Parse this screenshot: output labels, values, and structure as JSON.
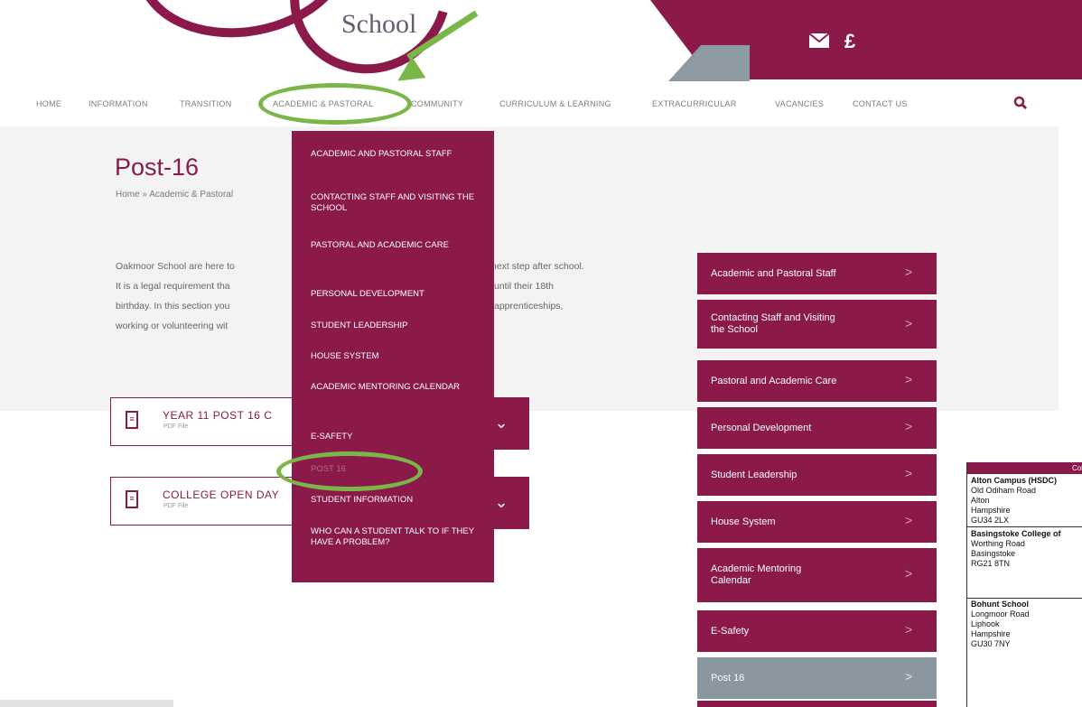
{
  "header": {
    "logo_text": "School",
    "mail_icon": "envelope-icon",
    "pound_symbol": "£",
    "brand_color": "#8b1a4a",
    "accent_grey": "#8a97a1",
    "annotation_color": "#7ab648"
  },
  "nav": {
    "items": [
      "HOME",
      "INFORMATION",
      "TRANSITION",
      "ACADEMIC & PASTORAL",
      "COMMUNITY",
      "CURRICULUM & LEARNING",
      "EXTRACURRICULAR",
      "VACANCIES",
      "CONTACT US"
    ],
    "search_icon": "search-icon"
  },
  "page": {
    "title": "Post-16",
    "breadcrumb": "Home » Academic & Pastoral",
    "paragraph": [
      "Oakmoor School are here to",
      "It is a legal requirement tha",
      "birthday.  In this section you",
      "working or volunteering wit"
    ],
    "paragraph_right": [
      "next step after school.",
      "until their 18th",
      "apprenticeships,",
      ""
    ]
  },
  "documents": [
    {
      "title": "YEAR 11 POST 16 C",
      "type": "PDF File"
    },
    {
      "title": "COLLEGE OPEN DAY",
      "type": "PDF File"
    }
  ],
  "dropdown": {
    "items": [
      "ACADEMIC AND PASTORAL STAFF",
      "CONTACTING STAFF AND VISITING THE SCHOOL",
      "PASTORAL AND ACADEMIC CARE",
      "PERSONAL DEVELOPMENT",
      "STUDENT LEADERSHIP",
      "HOUSE SYSTEM",
      "ACADEMIC MENTORING CALENDAR",
      "E-SAFETY",
      "POST 16",
      "STUDENT INFORMATION",
      "WHO CAN A STUDENT TALK TO IF THEY HAVE A PROBLEM?"
    ]
  },
  "sidebar": {
    "items": [
      "Academic and Pastoral Staff",
      "Contacting Staff and Visiting the School",
      "Pastoral and Academic Care",
      "Personal Development",
      "Student Leadership",
      "House System",
      "Academic Mentoring Calendar",
      "E-Safety",
      "Post 16"
    ],
    "chevron": ">"
  },
  "table": {
    "header": "Col",
    "rows": [
      {
        "name": "Alton Campus (HSDC)",
        "lines": [
          "Old Odiham Road",
          "Alton",
          "Hampshire",
          "GU34 2LX"
        ]
      },
      {
        "name": "Basingstoke College of",
        "lines": [
          "Worthing Road",
          "Basingstoke",
          "RG21 8TN"
        ]
      },
      {
        "name": "Bohunt School",
        "lines": [
          "Longmoor Road",
          "Liphook",
          "Hampshire",
          "GU30 7NY"
        ]
      }
    ]
  }
}
